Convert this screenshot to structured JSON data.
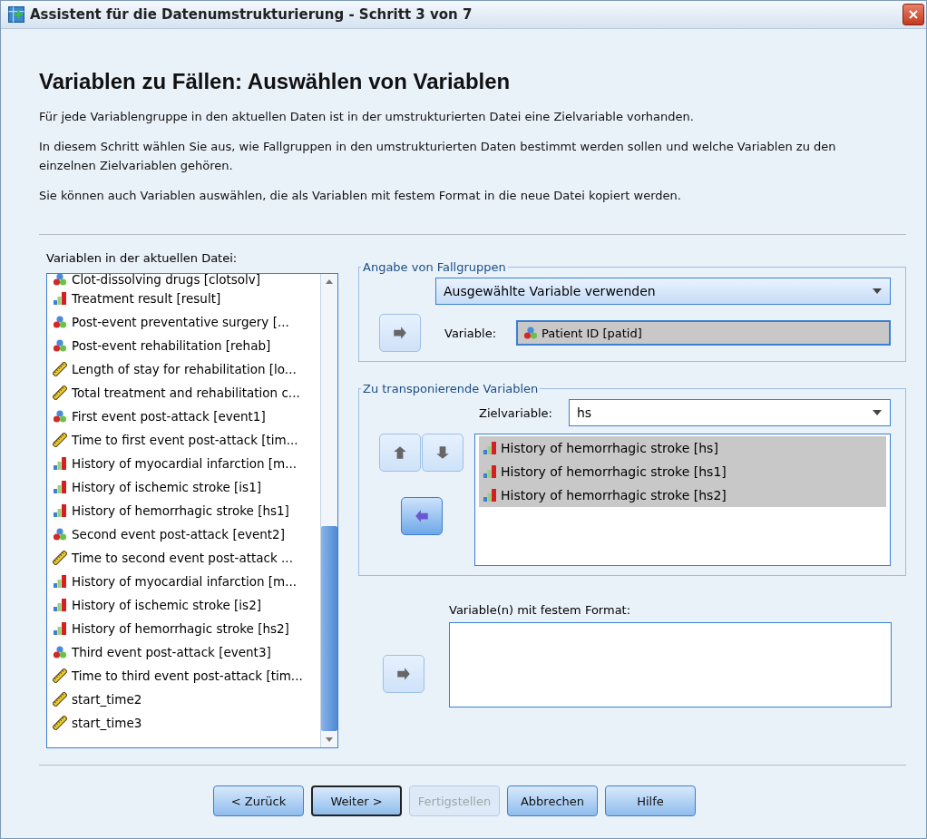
{
  "window": {
    "title": "Assistent für die Datenumstrukturierung - Schritt 3 von 7"
  },
  "heading": "Variablen zu Fällen: Auswählen von Variablen",
  "paragraphs": [
    "Für jede Variablengruppe in den aktuellen Daten ist in der umstrukturierten Datei eine Zielvariable vorhanden.",
    "In diesem Schritt wählen Sie aus, wie Fallgruppen in den umstrukturierten Daten bestimmt werden sollen und welche Variablen zu den einzelnen Zielvariablen gehören.",
    "Sie können auch Variablen auswählen, die als Variablen mit festem Format in die neue Datei kopiert werden."
  ],
  "source_list": {
    "label": "Variablen in der aktuellen Datei:",
    "items": [
      {
        "kind": "nominal",
        "label": "Clot-dissolving drugs [clotsolv]"
      },
      {
        "kind": "ordinal",
        "label": "Treatment result [result]"
      },
      {
        "kind": "nominal",
        "label": "Post-event preventative surgery [..."
      },
      {
        "kind": "nominal",
        "label": "Post-event rehabilitation [rehab]"
      },
      {
        "kind": "scale",
        "label": "Length of stay for rehabilitation [lo..."
      },
      {
        "kind": "scale",
        "label": "Total treatment and rehabilitation c..."
      },
      {
        "kind": "nominal",
        "label": "First event post-attack [event1]"
      },
      {
        "kind": "scale",
        "label": "Time to first event post-attack [tim..."
      },
      {
        "kind": "ordinal",
        "label": "History of myocardial infarction [m..."
      },
      {
        "kind": "ordinal",
        "label": "History of ischemic stroke [is1]"
      },
      {
        "kind": "ordinal",
        "label": "History of hemorrhagic stroke [hs1]"
      },
      {
        "kind": "nominal",
        "label": "Second event post-attack [event2]"
      },
      {
        "kind": "scale",
        "label": "Time to second event post-attack ..."
      },
      {
        "kind": "ordinal",
        "label": "History of myocardial infarction [m..."
      },
      {
        "kind": "ordinal",
        "label": "History of ischemic stroke [is2]"
      },
      {
        "kind": "ordinal",
        "label": "History of hemorrhagic stroke [hs2]"
      },
      {
        "kind": "nominal",
        "label": "Third event post-attack [event3]"
      },
      {
        "kind": "scale",
        "label": "Time to third event post-attack [tim..."
      },
      {
        "kind": "scale",
        "label": "start_time2"
      },
      {
        "kind": "scale",
        "label": "start_time3"
      }
    ]
  },
  "case_groups": {
    "title": "Angabe von Fallgruppen",
    "method": "Ausgewählte Variable verwenden",
    "move_button": {
      "active": false
    },
    "variable_label": "Variable:",
    "variable": {
      "kind": "nominal",
      "label": "Patient ID [patid]"
    }
  },
  "transpose": {
    "title": "Zu transponierende Variablen",
    "target_label": "Zielvariable:",
    "target": "hs",
    "up_button": {
      "active": false
    },
    "down_button": {
      "active": false
    },
    "move_button": {
      "active": true
    },
    "items": [
      {
        "kind": "ordinal",
        "label": "History of hemorrhagic stroke [hs]",
        "selected": true
      },
      {
        "kind": "ordinal",
        "label": "History of hemorrhagic stroke [hs1]",
        "selected": true
      },
      {
        "kind": "ordinal",
        "label": "History of hemorrhagic stroke [hs2]",
        "selected": true
      }
    ]
  },
  "fixed": {
    "label": "Variable(n) mit festem Format:",
    "move_button": {
      "active": false
    }
  },
  "buttons": [
    {
      "label": "< Zurück",
      "disabled": false,
      "default": false
    },
    {
      "label": "Weiter >",
      "disabled": false,
      "default": true
    },
    {
      "label": "Fertigstellen",
      "disabled": true,
      "default": false
    },
    {
      "label": "Abbrechen",
      "disabled": false,
      "default": false
    },
    {
      "label": "Hilfe",
      "disabled": false,
      "default": false
    }
  ]
}
